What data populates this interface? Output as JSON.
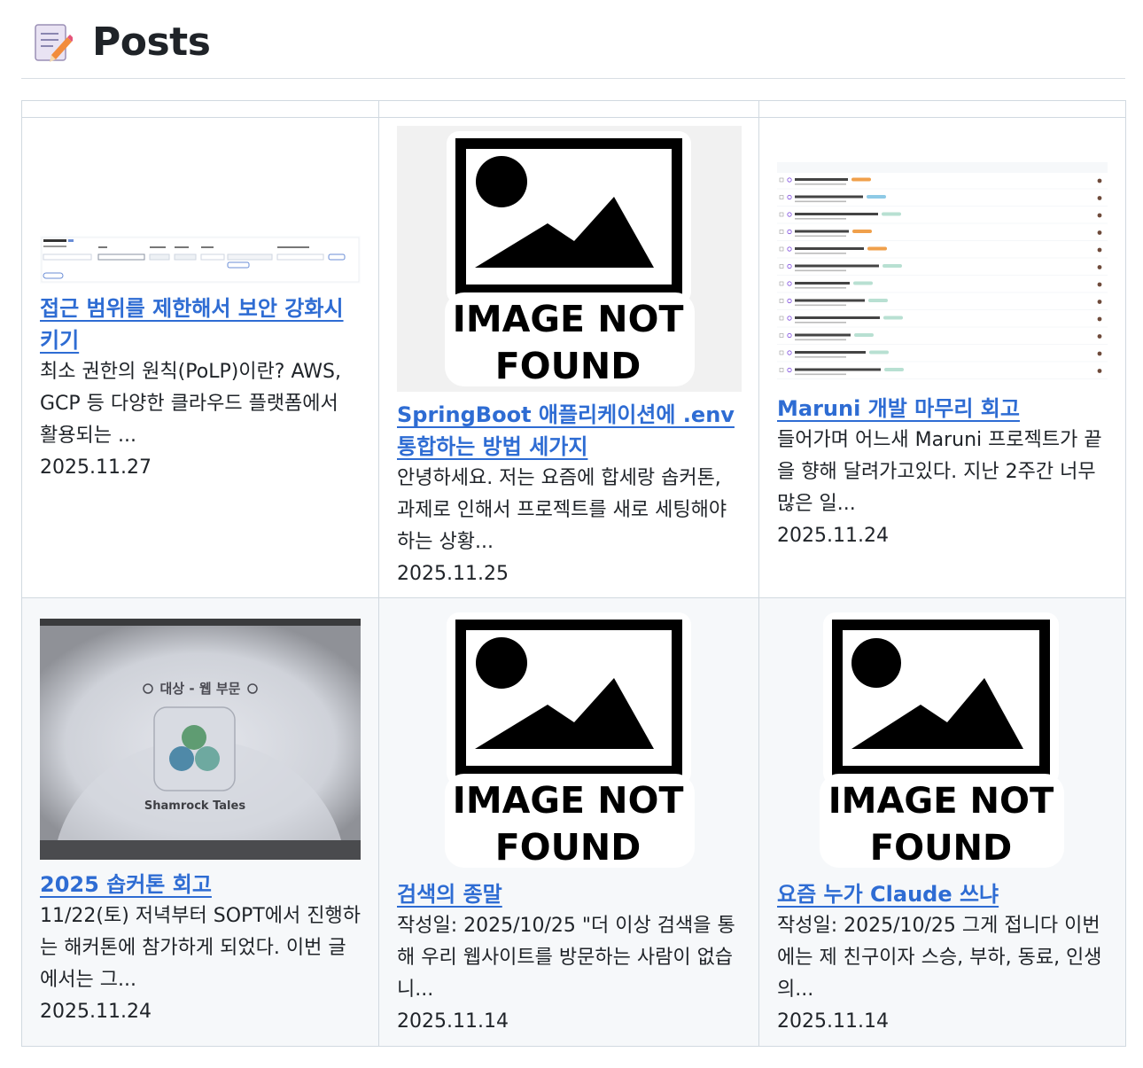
{
  "header": {
    "title": "Posts",
    "icon": "memo-icon"
  },
  "posts": [
    {
      "title": "접근 범위를 제한해서 보안 강화시키기",
      "excerpt": "최소 권한의 원칙(PoLP)이란? AWS, GCP 등 다양한 클라우드 플랫폼에서 활용되는 ...",
      "date": "2025.11.27",
      "thumbnail": "iam-settings-screenshot"
    },
    {
      "title": "SpringBoot 애플리케이션에 .env 통합하는 방법 세가지",
      "excerpt": "안녕하세요. 저는 요즘에 합세랑 솝커톤, 과제로 인해서 프로젝트를 새로 세팅해야 하는 상황...",
      "date": "2025.11.25",
      "thumbnail": "image-not-found"
    },
    {
      "title": "Maruni 개발 마무리 회고",
      "excerpt": "들어가며 어느새 Maruni 프로젝트가 끝을 향해 달려가고있다. 지난 2주간 너무 많은 일...",
      "date": "2025.11.24",
      "thumbnail": "github-issues-screenshot"
    },
    {
      "title": "2025 솝커톤 회고",
      "excerpt": "11/22(토) 저녁부터 SOPT에서 진행하는 해커톤에 참가하게 되었다. 이번 글에서는 그...",
      "date": "2025.11.24",
      "thumbnail": "award-slide-photo"
    },
    {
      "title": "검색의 종말",
      "excerpt": "작성일: 2025/10/25 \"더 이상 검색을 통해 우리 웹사이트를 방문하는 사람이 없습니...",
      "date": "2025.11.14",
      "thumbnail": "image-not-found"
    },
    {
      "title": "요즘 누가 Claude 쓰냐",
      "excerpt": "작성일: 2025/10/25 그게 접니다 이번에는 제 친구이자 스승, 부하, 동료, 인생의...",
      "date": "2025.11.14",
      "thumbnail": "image-not-found"
    }
  ],
  "placeholder": {
    "line1": "IMAGE NOT",
    "line2": "FOUND"
  },
  "slide": {
    "award": "대상 - 웹 부문",
    "team": "Shamrock Tales"
  },
  "colors": {
    "link": "#2e6cd3",
    "border": "#d1d9e0",
    "alt_row": "#f6f8fa"
  }
}
